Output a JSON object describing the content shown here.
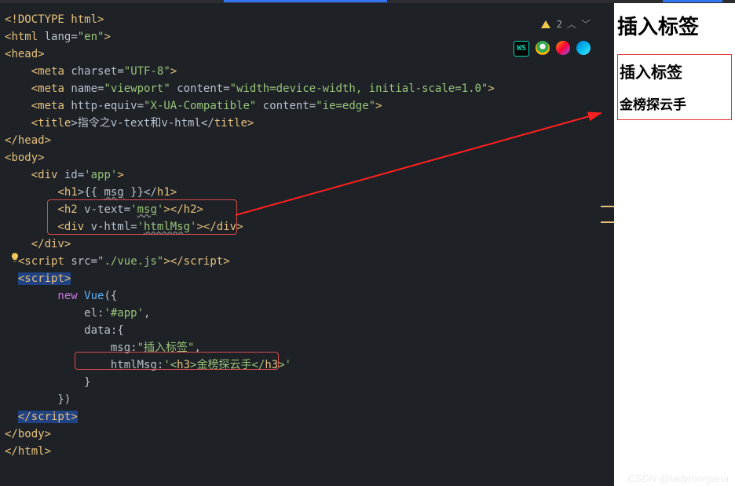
{
  "status": {
    "warn_count": "2"
  },
  "icons": {
    "ws": "WS"
  },
  "code": {
    "l1a": "<!",
    "l1b": "DOCTYPE ",
    "l1c": "html",
    "l1d": ">",
    "l2a": "<",
    "l2b": "html ",
    "l2c": "lang",
    "l2d": "=",
    "l2e": "\"en\"",
    "l2f": ">",
    "l3a": "<",
    "l3b": "head",
    "l3c": ">",
    "l4a": "    <",
    "l4b": "meta ",
    "l4c": "charset",
    "l4d": "=",
    "l4e": "\"UTF-8\"",
    "l4f": ">",
    "l5a": "    <",
    "l5b": "meta ",
    "l5c": "name",
    "l5d": "=",
    "l5e": "\"viewport\" ",
    "l5f": "content",
    "l5g": "=",
    "l5h": "\"width=device-width, initial-scale=1.0\"",
    "l5i": ">",
    "l6a": "    <",
    "l6b": "meta ",
    "l6c": "http-equiv",
    "l6d": "=",
    "l6e": "\"X-UA-Compatible\" ",
    "l6f": "content",
    "l6g": "=",
    "l6h": "\"ie=edge\"",
    "l6i": ">",
    "l7a": "    <",
    "l7b": "title",
    "l7c": ">指令之v-text和v-html</",
    "l7d": "title",
    "l7e": ">",
    "l8a": "</",
    "l8b": "head",
    "l8c": ">",
    "l9a": "<",
    "l9b": "body",
    "l9c": ">",
    "l10a": "    <",
    "l10b": "div ",
    "l10c": "id",
    "l10d": "=",
    "l10e": "'app'",
    "l10f": ">",
    "l11a": "        <",
    "l11b": "h1",
    "l11c": ">{{ ",
    "l11d": "msg",
    "l11e": " }}</",
    "l11f": "h1",
    "l11g": ">",
    "l12a": "        <",
    "l12b": "h2 ",
    "l12c": "v-text",
    "l12d": "=",
    "l12e": "'",
    "l12f": "msg",
    "l12g": "'",
    "l12h": "></",
    "l12i": "h2",
    "l12j": ">",
    "l13a": "        <",
    "l13b": "div ",
    "l13c": "v-html",
    "l13d": "=",
    "l13e": "'",
    "l13f": "htmlMsg",
    "l13g": "'",
    "l13h": "></",
    "l13i": "div",
    "l13j": ">",
    "l14a": "    </",
    "l14b": "div",
    "l14c": ">",
    "l15a": "  <",
    "l15b": "script ",
    "l15c": "src",
    "l15d": "=",
    "l15e": "\"./vue.js\"",
    "l15f": "></",
    "l15g": "script",
    "l15h": ">",
    "l16a": "  ",
    "l16b": "<",
    "l16c": "script",
    "l16d": ">",
    "l17a": "        new ",
    "l17b": "Vue",
    "l17c": "({",
    "l18a": "            ",
    "l18b": "el",
    "l18c": ":",
    "l18d": "'#app'",
    "l18e": ",",
    "l19a": "            ",
    "l19b": "data",
    "l19c": ":{",
    "l20a": "                ",
    "l20b": "msg",
    "l20c": ":",
    "l20d": "\"插入标签\"",
    "l20e": ",",
    "l21a": "                ",
    "l21b": "htmlMsg",
    "l21c": ":",
    "l21d": "'<",
    "l21e": "h3",
    "l21f": ">金榜探云手</",
    "l21g": "h3",
    "l21h": ">'",
    "l22a": "            }",
    "l23a": "        })",
    "l24a": "  ",
    "l24b": "</",
    "l24c": "script",
    "l24d": ">",
    "l25a": "</",
    "l25b": "body",
    "l25c": ">",
    "l26a": "</",
    "l26b": "html",
    "l26c": ">"
  },
  "preview": {
    "h1": "插入标签",
    "h2": "插入标签",
    "h3": "金榜探云手"
  },
  "watermark": "CSDN @ladymorgana"
}
